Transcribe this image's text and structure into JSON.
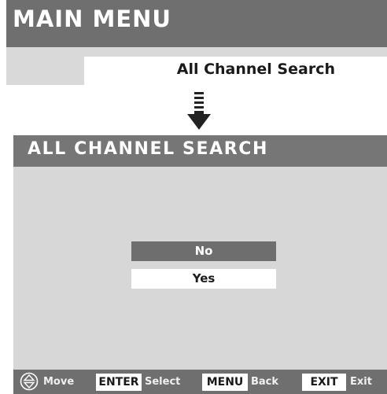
{
  "main_menu": {
    "title": "MAIN MENU",
    "item": "All Channel Search"
  },
  "screen": {
    "title": "ALL CHANNEL SEARCH",
    "options": [
      {
        "label": "No",
        "selected": true
      },
      {
        "label": "Yes",
        "selected": false
      }
    ]
  },
  "footer": {
    "move_label": "Move",
    "enter_key": "ENTER",
    "enter_label": "Select",
    "menu_key": "MENU",
    "menu_label": "Back",
    "exit_key": "EXIT",
    "exit_label": "Exit"
  },
  "icons": {
    "move": "up-down-arrows-icon",
    "transition": "down-arrow-icon"
  },
  "colors": {
    "header_gray": "#6f6f6f",
    "panel_gray": "#d7d7d7",
    "selected_gray": "#6e6e6e",
    "white": "#ffffff"
  }
}
